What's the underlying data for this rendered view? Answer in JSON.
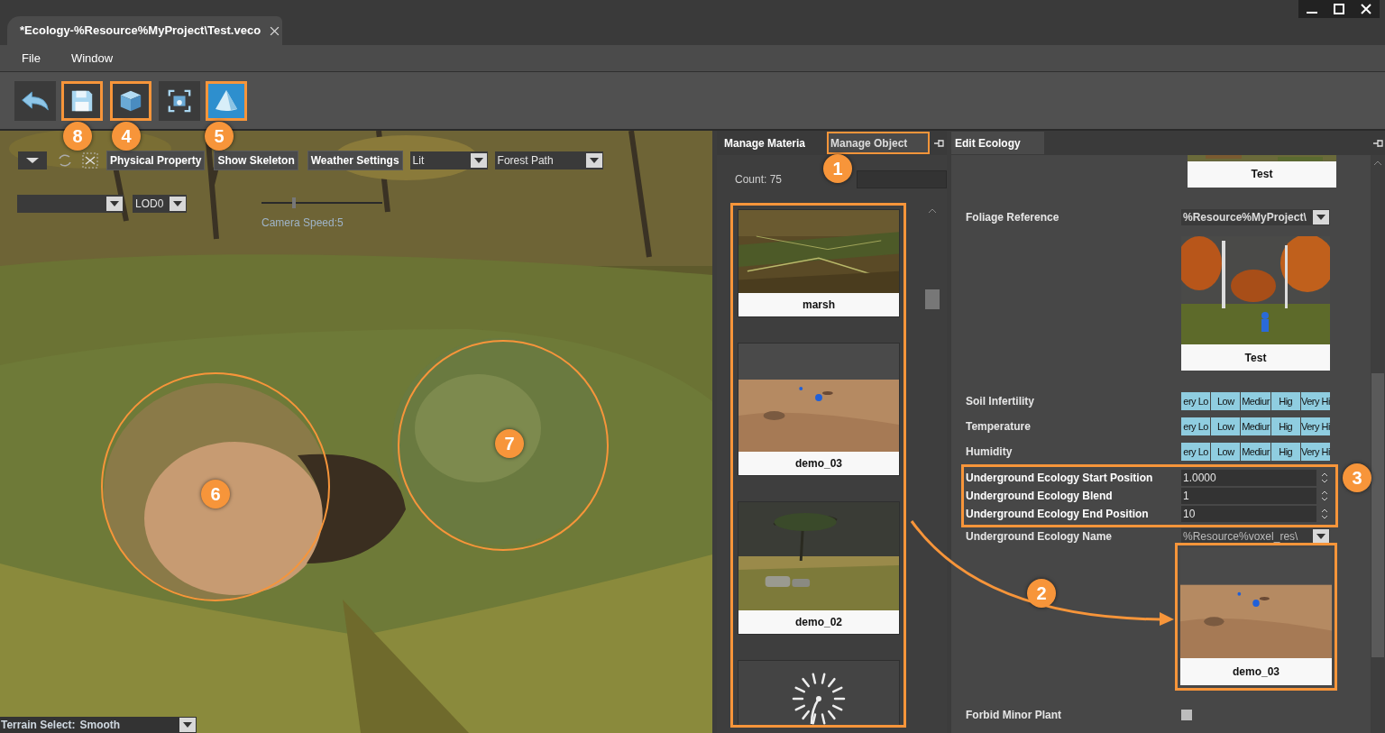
{
  "window": {
    "tab_title": "*Ecology-%Resource%MyProject\\Test.veco"
  },
  "menu": [
    "File",
    "Window"
  ],
  "toolbar": [
    {
      "kind": "undo",
      "selected": false
    },
    {
      "kind": "save",
      "selected": false,
      "callout": "8"
    },
    {
      "kind": "cube",
      "selected": false,
      "callout": "4"
    },
    {
      "kind": "focus",
      "selected": false
    },
    {
      "kind": "terrain",
      "selected": true,
      "callout": "5"
    }
  ],
  "viewport": {
    "buttons": [
      "Physical Property",
      "Show Skeleton",
      "Weather Settings"
    ],
    "shading": "Lit",
    "scene": "Forest Path",
    "lod": "LOD0",
    "camera_speed": {
      "label": "Camera Speed:5",
      "level": 0.27
    },
    "terrain_select": {
      "label": "Terrain Select:",
      "value": "Smooth"
    },
    "callouts": [
      "6",
      "7"
    ]
  },
  "manage_panel": {
    "tabs": [
      {
        "label": "Manage Materia",
        "selected": false
      },
      {
        "label": "Manage Object",
        "selected": true,
        "callout": "1"
      }
    ],
    "count": "Count: 75",
    "items": [
      {
        "name": "marsh",
        "kind": "marsh"
      },
      {
        "name": "demo_03",
        "kind": "desert"
      },
      {
        "name": "demo_02",
        "kind": "savanna"
      },
      {
        "kind": "logo"
      }
    ]
  },
  "edit_panel": {
    "tab": "Edit Ecology",
    "top_caption": "Test",
    "foliage": {
      "label": "Foliage Reference",
      "value": "%Resource%MyProject\\",
      "caption": "Test"
    },
    "ranges": [
      {
        "label": "Soil Infertility",
        "segments": [
          "ery Lo",
          "Low",
          "Mediur",
          "Hig",
          "Very Hi"
        ]
      },
      {
        "label": "Temperature",
        "segments": [
          "ery Lo",
          "Low",
          "Mediur",
          "Hig",
          "Very Hi"
        ]
      },
      {
        "label": "Humidity",
        "segments": [
          "ery Lo",
          "Low",
          "Mediur",
          "Hig",
          "Very Hi"
        ]
      }
    ],
    "spin_rows": [
      {
        "label": "Underground Ecology Start Position",
        "value": "1.0000"
      },
      {
        "label": "Underground Ecology Blend",
        "value": "1"
      },
      {
        "label": "Underground Ecology End Position",
        "value": "10"
      }
    ],
    "spin_callout": "3",
    "underground_name": {
      "label": "Underground Ecology Name",
      "value": "%Resource%voxel_res\\",
      "caption": "demo_03",
      "callout": "2"
    },
    "forbid_minor_plant": {
      "label": "Forbid Minor Plant",
      "checked": false
    }
  }
}
